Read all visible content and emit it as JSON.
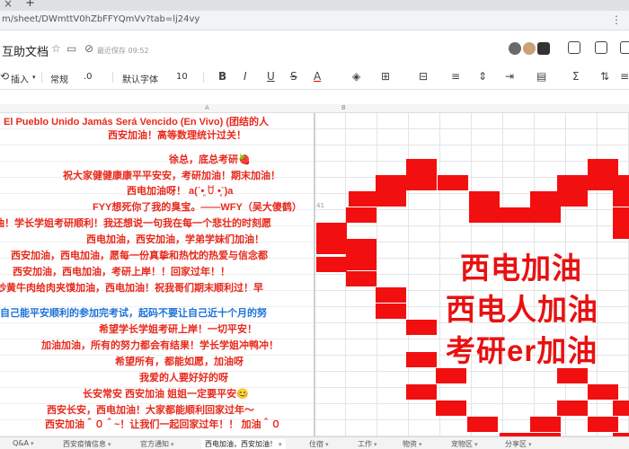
{
  "browser": {
    "tab_close": "×",
    "tab_new": "+",
    "url": "m/sheet/DWmttV0hZbFFYQmVv?tab=lj24vy",
    "menu": "⋮"
  },
  "doc": {
    "title": "互助文档",
    "saved_status": "最近保存 09:52"
  },
  "toolbar": {
    "undo": "⟲",
    "insert": "插入",
    "format_normal": "常规",
    "decimal": ".0",
    "font": "默认字体",
    "font_size": "10",
    "bold": "B",
    "italic": "I",
    "underline": "U",
    "strikethrough": "S",
    "text_color": "A",
    "sum": "Σ"
  },
  "columns": [
    "A",
    "B"
  ],
  "messages": [
    {
      "text": "El Pueblo Unido Jamás Será Vencido (En Vivo) (团结的人",
      "color": "red"
    },
    {
      "text": "西安加油！高等数理统计过关！",
      "color": "red"
    },
    {
      "text": "徐总，底总考研🍓",
      "color": "red"
    },
    {
      "text": "祝大家健健康康平平安安，考研加油！期末加油！",
      "color": "red"
    },
    {
      "text": "西电加油呀！ a(ˊ•͈ ꇴ •͈ˋ)a",
      "color": "red"
    },
    {
      "text": "FYY想死你了我的臭宝。——WFY（吴大傻鹤）",
      "color": "red"
    },
    {
      "text": "油！学长学姐考研顺利！我还想说一句我在每一个悲壮的时刻愿",
      "color": "red"
    },
    {
      "text": "西电加油，西安加油，学弟学妹们加油！",
      "color": "red"
    },
    {
      "text": "西安加油，西电加油，愿每一份真挚和热忱的热爱与信念都",
      "color": "red"
    },
    {
      "text": "西安加油，西电加油，考研上岸！！回家过年！！",
      "color": "red"
    },
    {
      "text": "炒黄牛肉给肉夹馍加油，西电加油！祝我哥们期末顺利过！早",
      "color": "red"
    },
    {
      "text": "自己能平安顺利的参加完考试，起码不要让自己近十个月的努",
      "color": "blue"
    },
    {
      "text": "希望学长学姐考研上岸！一切平安！",
      "color": "red"
    },
    {
      "text": "加油加油，所有的努力都会有结果！学长学姐冲鸭冲！",
      "color": "red"
    },
    {
      "text": "希望所有，都能如愿，加油呀",
      "color": "red"
    },
    {
      "text": "我爱的人要好好的呀",
      "color": "red"
    },
    {
      "text": "长安常安   西安加油    姐姐一定要平安😊",
      "color": "red"
    },
    {
      "text": "西安长安，西电加油！大家都能顺利回家过年～",
      "color": "red"
    },
    {
      "text": "西安加油＾０＾~！让我们一起回家过年！！ 加油＾０",
      "color": "red"
    }
  ],
  "heart": {
    "lines": [
      "西电加油",
      "西电人加油",
      "考研er加油"
    ],
    "color": "#f20f0f",
    "row_marker": "41"
  },
  "sheet_tabs": [
    {
      "label": "Q&A",
      "active": false
    },
    {
      "label": "西安疫情信息",
      "active": false
    },
    {
      "label": "官方通知",
      "active": false
    },
    {
      "label": "西电加油，西安加油！",
      "active": true
    },
    {
      "label": "住宿",
      "active": false
    },
    {
      "label": "工作",
      "active": false
    },
    {
      "label": "物资",
      "active": false
    },
    {
      "label": "宠物区",
      "active": false
    },
    {
      "label": "分享区",
      "active": false
    }
  ],
  "colors": {
    "accent_red": "#e8291c",
    "accent_blue": "#1e73d8"
  }
}
